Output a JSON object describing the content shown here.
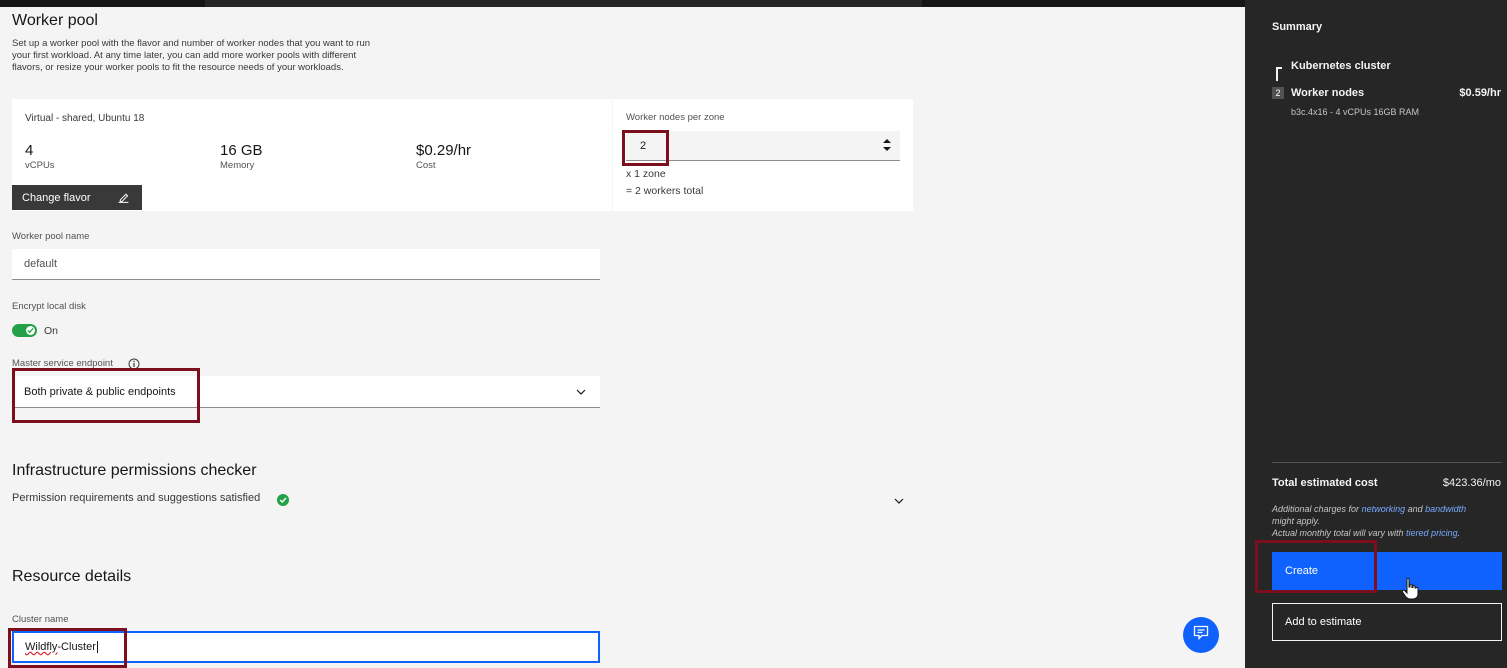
{
  "worker_pool": {
    "title": "Worker pool",
    "description_1": "Set up a worker pool with the flavor and number of worker nodes that you want to run",
    "description_2": "your first workload. At any time later, you can add more worker pools with different",
    "description_3": "flavors, or resize your worker pools to fit the resource needs of your workloads.",
    "flavor_type": "Virtual - shared, Ubuntu 18",
    "vcpus_value": "4",
    "vcpus_label": "vCPUs",
    "memory_value": "16 GB",
    "memory_label": "Memory",
    "cost_value": "$0.29/hr",
    "cost_label": "Cost",
    "change_flavor_label": "Change flavor",
    "nodes_per_zone_label": "Worker nodes per zone",
    "nodes_per_zone_value": "2",
    "zone_text": "x 1 zone",
    "workers_total_text": "= 2 workers total",
    "pool_name_label": "Worker pool name",
    "pool_name_placeholder": "default",
    "encrypt_label": "Encrypt local disk",
    "encrypt_state": "On",
    "endpoint_label": "Master service endpoint",
    "endpoint_value": "Both private & public endpoints"
  },
  "infrastructure": {
    "title": "Infrastructure permissions checker",
    "status": "Permission requirements and suggestions satisfied"
  },
  "resource_details": {
    "title": "Resource details",
    "cluster_name_label": "Cluster name",
    "cluster_name_prefix": "Wildfly",
    "cluster_name_suffix": "-Cluster"
  },
  "summary": {
    "title": "Summary",
    "cluster_label": "Kubernetes cluster",
    "node_count": "2",
    "nodes_label": "Worker nodes",
    "nodes_price": "$0.59/hr",
    "nodes_spec": "b3c.4x16 - 4 vCPUs 16GB RAM",
    "total_label": "Total estimated cost",
    "total_value": "$423.36/mo",
    "note_prefix": "Additional charges for ",
    "note_link_1": "networking",
    "note_and": " and ",
    "note_link_2": "bandwidth",
    "note_line2": "might apply.",
    "note_line3_prefix": "Actual monthly total will vary with ",
    "note_link_3": "tiered pricing",
    "note_line3_suffix": ".",
    "create_label": "Create",
    "estimate_label": "Add to estimate"
  },
  "colors": {
    "primary": "#0f62fe",
    "annotation": "#7b0f1e",
    "toggle_on": "#24a148",
    "panel_dark": "#262626"
  }
}
